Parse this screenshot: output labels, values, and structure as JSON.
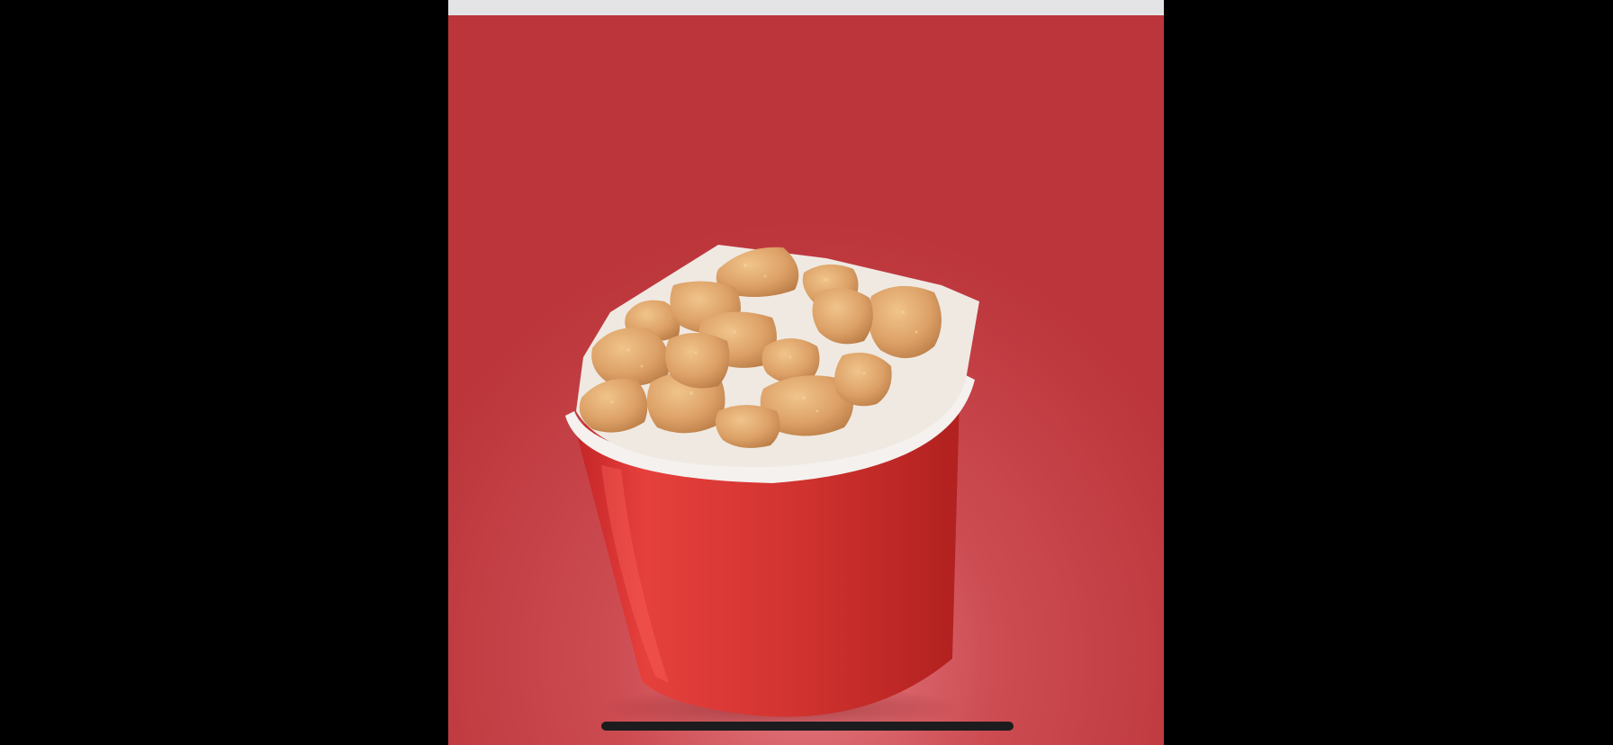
{
  "screen": {
    "background_color": "#000000"
  },
  "viewer": {
    "top_strip_color": "#e4e4e6",
    "photo": {
      "subject": "chicken-nuggets-bucket-photo",
      "background_color": "#bd363a",
      "bucket_color": "#d8302f",
      "nugget_color": "#d9a066"
    }
  },
  "home_indicator": {
    "color": "#1c1c1e"
  }
}
